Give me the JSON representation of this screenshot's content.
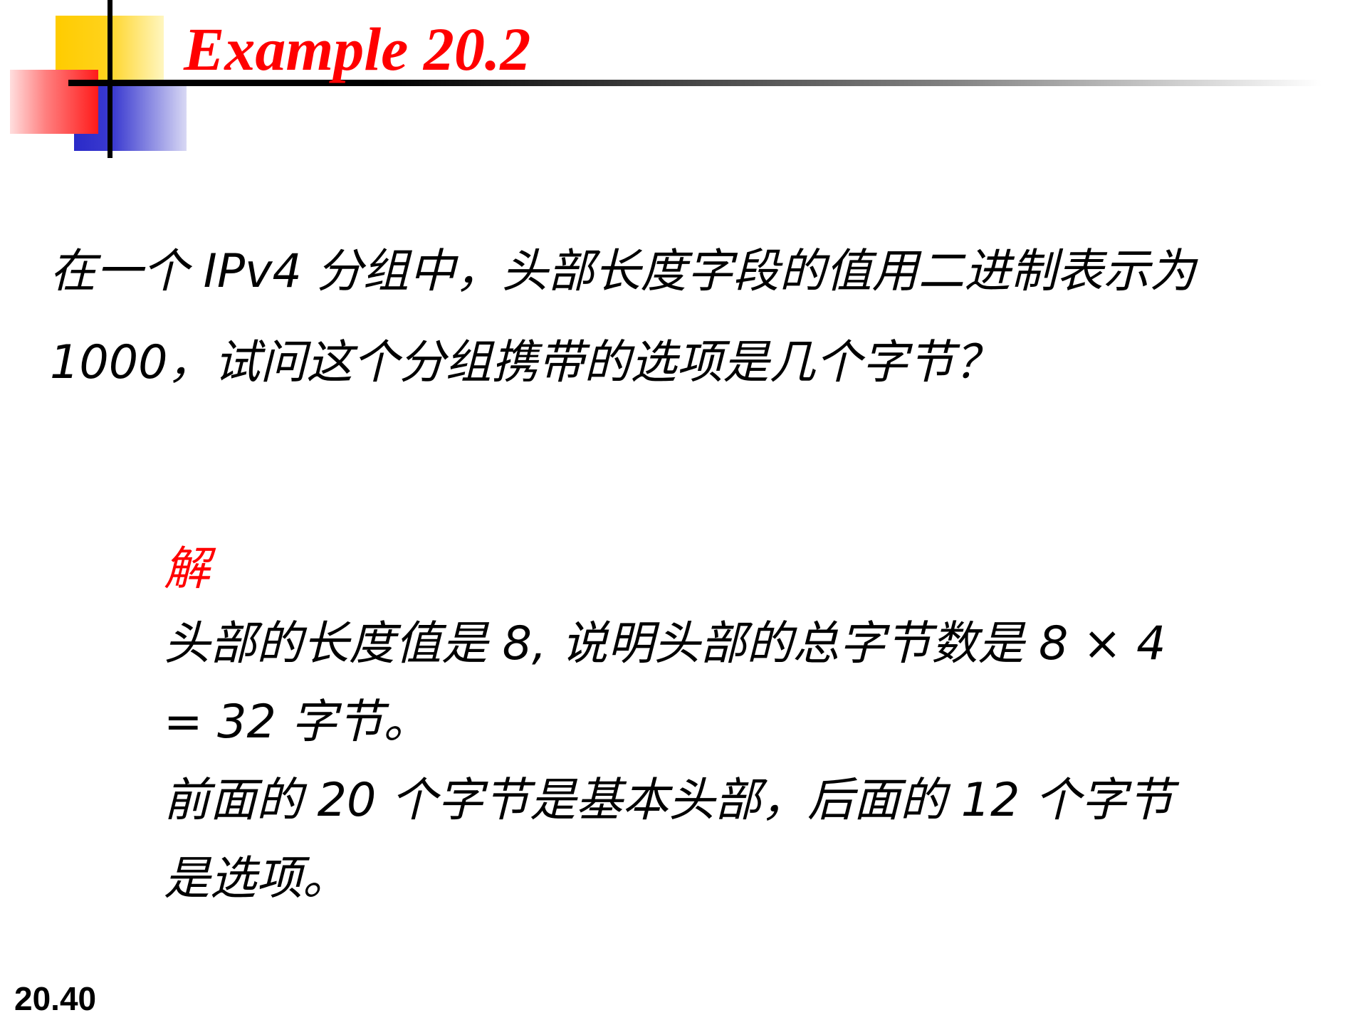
{
  "slide": {
    "title": "Example 20.2",
    "question": "在一个 IPv4 分组中，头部长度字段的值用二进制表示为1000，试问这个分组携带的选项是几个字节？",
    "answer_label": "解",
    "answer_lines": [
      "头部的长度值是 8, 说明头部的总字节数是 8 × 4 = 32 字节。",
      "前面的 20 个字节是基本头部，后面的 12 个字节是选项。"
    ],
    "page_number": "20.40"
  },
  "colors": {
    "title": "#ff0000",
    "answer_label": "#ff0000",
    "body_text": "#000000",
    "logo_yellow": "#ffcc00",
    "logo_blue": "#2a2ac8",
    "logo_red": "#ff1a1a"
  }
}
